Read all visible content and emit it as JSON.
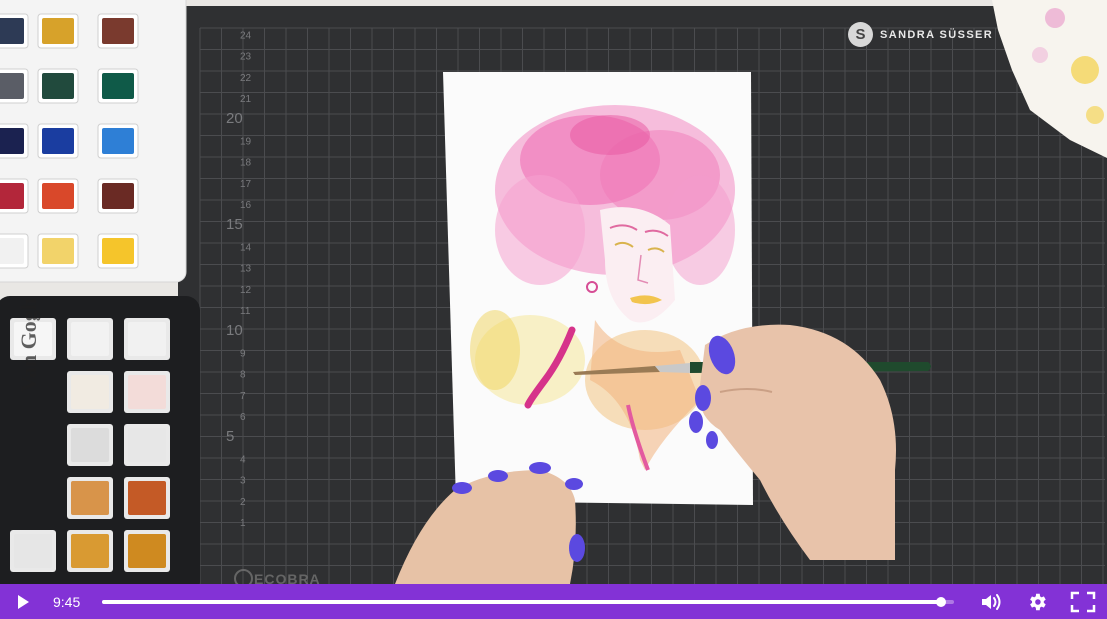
{
  "video": {
    "watermark_initial": "S",
    "watermark_text": "SANDRA SÜSSER",
    "mat_brand": "ECOBRA",
    "palette_brand": "Van Gogh"
  },
  "player": {
    "current_time": "9:45",
    "progress": 0.985,
    "accent_color": "#8332d6"
  },
  "icons": {
    "play": "play-icon",
    "volume": "volume-icon",
    "settings": "gear-icon",
    "fullscreen": "fullscreen-icon"
  }
}
